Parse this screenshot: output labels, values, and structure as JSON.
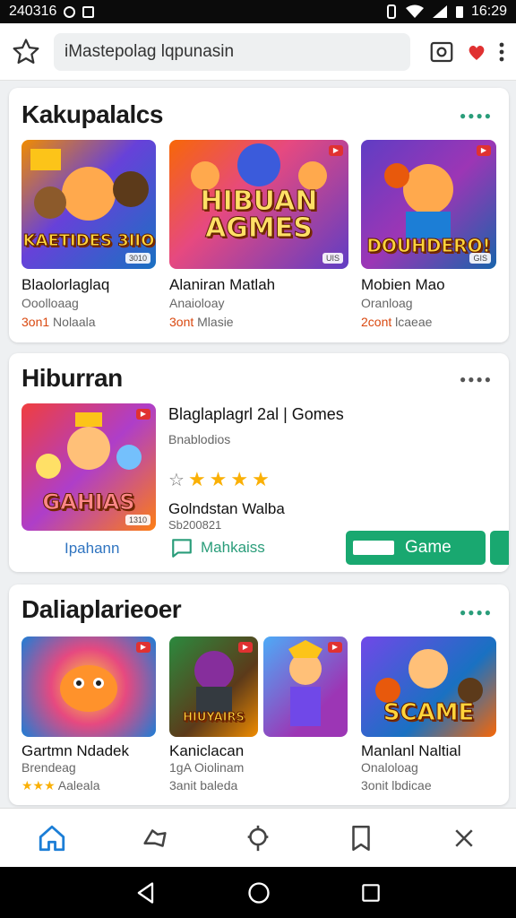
{
  "status_bar": {
    "left_text": "240316",
    "time": "16:29"
  },
  "search": {
    "value": "iMastepolag lqpunasin"
  },
  "sections": [
    {
      "title": "Kakupalalcs",
      "apps": [
        {
          "name": "Blaolorlaglaq",
          "sub": "Ooolloaag",
          "meta_red": "3on1",
          "meta": "Nolaala",
          "art": "KAETIDES 3IIO",
          "tag": "3010"
        },
        {
          "name": "Alaniran Matlah",
          "sub": "Anaioloay",
          "meta_red": "3ont",
          "meta": "Mlasie",
          "art": "HIBUAN AGMES",
          "tag": "UIS"
        },
        {
          "name": "Mobien Mao",
          "sub": "Oranloag",
          "meta_red": "2cont",
          "meta": "lcaeae",
          "art": "DOUHDERO!",
          "tag": "GIS"
        }
      ]
    },
    {
      "title": "Hiburran",
      "featured": {
        "title": "Blaglaplagrl 2al | Gomes",
        "sub": "Bnablodios",
        "line1": "Golndstan Walba",
        "line2": "Sb200821",
        "link": "Ipahann",
        "chat": "Mahkaiss",
        "button": "Game",
        "art": "GAHIAS",
        "tag": "1310",
        "rating": 4
      }
    },
    {
      "title": "Daliaplarieoer",
      "apps": [
        {
          "name": "Gartmn Ndadek",
          "sub": "Brendeag",
          "meta": "Aaleala",
          "art": "",
          "stars": "★★★"
        },
        {
          "name": "Kaniclacan",
          "sub": "1gA Oiolinam",
          "meta": "3anit baleda",
          "art": "HIUYAIRS"
        },
        {
          "name": "Manlanl Naltial",
          "sub": "Onaloloag",
          "meta": "3onit lbdicae",
          "art": "SCAME"
        }
      ]
    }
  ],
  "colors": {
    "accent": "#19a870",
    "brand_green": "#2a9d7a",
    "star": "#fab005",
    "link": "#2f74c0"
  }
}
